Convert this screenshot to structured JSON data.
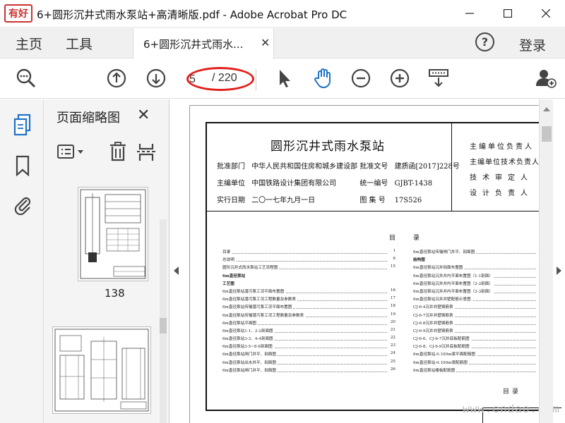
{
  "window": {
    "title": "6+圆形沉井式雨水泵站+高清晰版.pdf - Adobe Acrobat Pro DC",
    "logo_text": "有好"
  },
  "tabs": {
    "home": "主页",
    "tools": "工具",
    "document": "6+圆形沉井式雨水...",
    "login": "登录"
  },
  "toolbar": {
    "current_page": "5",
    "page_total": "/ 220"
  },
  "colors": {
    "annotation_ellipse": "#e3201b",
    "acrobat_blue": "#1f72c6"
  },
  "icons": {
    "rail": [
      "page-thumbnails-icon",
      "bookmark-icon",
      "attachment-icon"
    ],
    "toolbar": [
      "search-zoom-icon",
      "prev-page-icon",
      "next-page-icon",
      "select-cursor-icon",
      "hand-tool-icon",
      "zoom-out-icon",
      "zoom-in-icon",
      "scroll-mode-icon",
      "share-user-icon"
    ]
  },
  "thumbnail_panel": {
    "title": "页面缩略图",
    "thumbnails": [
      {
        "label": "138"
      }
    ]
  },
  "document_page": {
    "title": "圆形沉井式雨水泵站",
    "meta": [
      {
        "label1": "批准部门",
        "value1": "中华人民共和国住房和城乡建设部",
        "label2": "批准文号",
        "value2": "建质函[2017]228号"
      },
      {
        "label1": "主编单位",
        "value1": "中国铁路设计集团有限公司",
        "label2": "统一编号",
        "value2": "GJBT-1438"
      },
      {
        "label1": "实行日期",
        "value1": "二〇一七年九月一日",
        "label2": "图 集 号",
        "value2": "17S526"
      }
    ],
    "responsibility": [
      "主编单位负责人",
      "主编单位技术负责人",
      "技术审定人",
      "设计负责人"
    ],
    "toc_heading_left": "目",
    "toc_heading_right": "录",
    "toc_left": [
      {
        "t": "目录",
        "p": "1"
      },
      {
        "t": "总说明",
        "p": "6"
      },
      {
        "t": "圆形沉井式雨水泵站工艺流程图",
        "p": "15"
      },
      {
        "t": "6m直径泵站",
        "p": "",
        "section": true
      },
      {
        "t": "工艺图",
        "p": "",
        "section": true
      },
      {
        "t": "6m直径泵站潜污泵工况平面布置图",
        "p": "16"
      },
      {
        "t": "6m直径泵站潜污泵工况工程数量及参数表",
        "p": "17"
      },
      {
        "t": "6m直径泵站传输潜污泵工况平面布置图",
        "p": "18"
      },
      {
        "t": "6m直径泵站传输潜污泵工况工程数量及参数表",
        "p": "19"
      },
      {
        "t": "6m直径泵站平面图",
        "p": "20"
      },
      {
        "t": "6m直径泵站1-1、2-2剖面图",
        "p": "21"
      },
      {
        "t": "6m直径泵站3-3、4-4剖面图",
        "p": "22"
      },
      {
        "t": "6m直径泵站3-5~8-8剖面图",
        "p": "23"
      },
      {
        "t": "6m直径泵站闸门井平、剖面图",
        "p": "24"
      },
      {
        "t": "6m直径泵站出水井平、剖面图",
        "p": "25"
      },
      {
        "t": "6m直径泵站闸门井平、剖面图",
        "p": "26"
      }
    ],
    "toc_right": [
      {
        "t": "6m直径泵站传输闸门井平、剖面图",
        "p": ""
      },
      {
        "t": "结构图",
        "p": "",
        "section": true
      },
      {
        "t": "6m直径泵站沉井剖面布置图",
        "p": ""
      },
      {
        "t": "6m直径泵站沉井井内平面布置图（1-1剖面）",
        "p": ""
      },
      {
        "t": "6m直径泵站沉井井内平面布置图（2-2剖面）",
        "p": ""
      },
      {
        "t": "6m直径泵站沉井井内平面布置图（3-3剖面）",
        "p": ""
      },
      {
        "t": "6m直径泵站沉井井壁配筋示意图",
        "p": ""
      },
      {
        "t": "CJ-6-4沉井井壁钢筋表",
        "p": ""
      },
      {
        "t": "CJ-6-7沉井井壁钢筋表",
        "p": ""
      },
      {
        "t": "CJ-6-8沉井井壁钢筋表",
        "p": ""
      },
      {
        "t": "CJ-6-9沉井井壁钢筋表",
        "p": ""
      },
      {
        "t": "CJ-6-6、CJ-6-7沉井底板配筋图",
        "p": ""
      },
      {
        "t": "CJ-6-8、CJ-6-9沉井底板配筋图",
        "p": ""
      },
      {
        "t": "6m直径泵站-0.100m梁平面配筋图",
        "p": ""
      },
      {
        "t": "6m直径泵站-0.100m梁配筋图",
        "p": ""
      },
      {
        "t": "6m直径泵站楼板配筋图",
        "p": ""
      }
    ],
    "mini_table_title": "目录"
  },
  "watermark": "www.cndao.com"
}
